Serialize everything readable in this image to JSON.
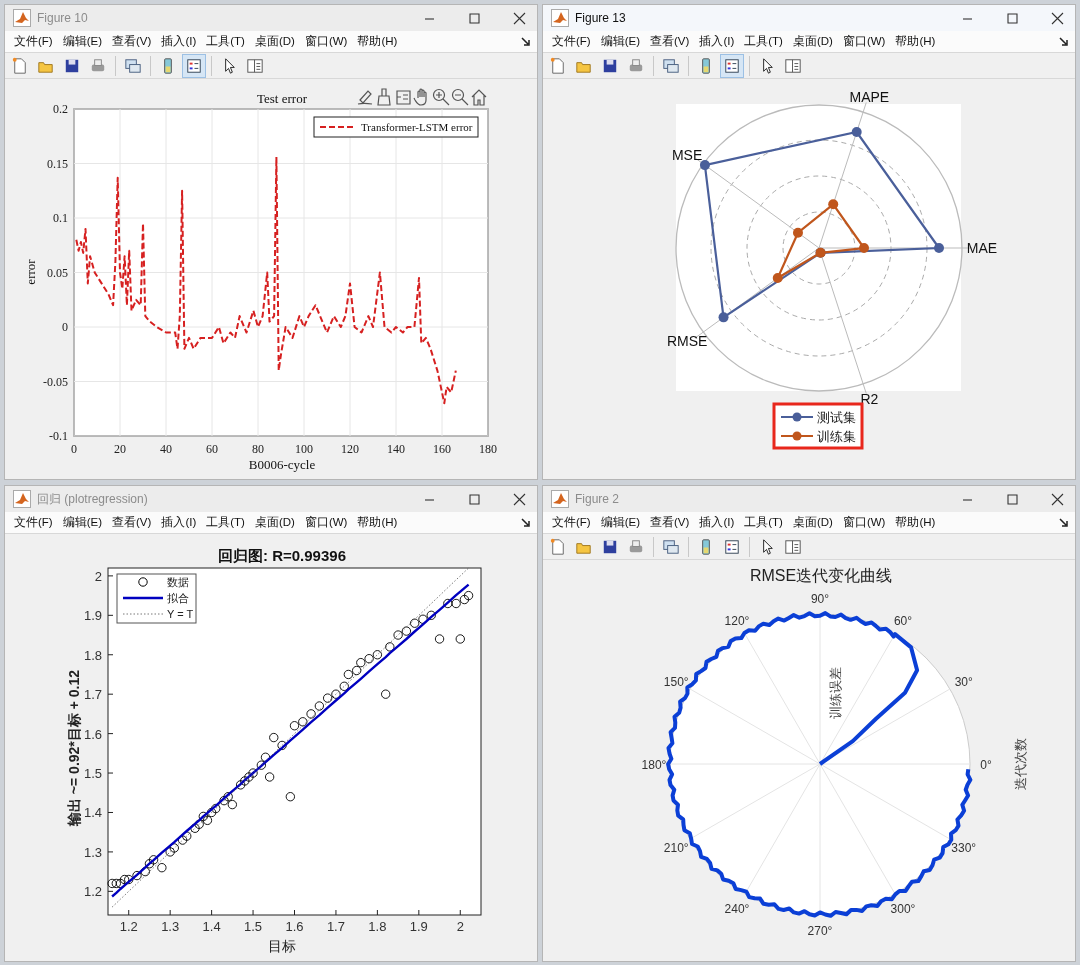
{
  "windows": [
    {
      "kind": "error_plot",
      "title": "Figure 10",
      "active": false,
      "menu": [
        "文件(F)",
        "编辑(E)",
        "查看(V)",
        "插入(I)",
        "工具(T)",
        "桌面(D)",
        "窗口(W)",
        "帮助(H)"
      ],
      "toolbar": [
        {
          "kind": "new",
          "selected": false
        },
        {
          "kind": "open",
          "selected": false
        },
        {
          "kind": "save",
          "selected": false
        },
        {
          "kind": "print",
          "selected": false
        },
        {
          "kind": "link",
          "selected": false
        },
        {
          "kind": "colorbar",
          "selected": false
        },
        {
          "kind": "legend",
          "selected": true
        },
        {
          "kind": "pointer",
          "selected": false
        },
        {
          "kind": "panel",
          "selected": false
        }
      ],
      "axes_toolbar": true,
      "chart_data": {
        "type": "line",
        "title": "Test error",
        "xlabel": "B0006-cycle",
        "ylabel": "error",
        "x": [
          1,
          2,
          3,
          4,
          5,
          6,
          7,
          9,
          12,
          15,
          17,
          18,
          19,
          20,
          21,
          22,
          23,
          24,
          25,
          27,
          29,
          30,
          31,
          33,
          36,
          40,
          44,
          45,
          46,
          47,
          48,
          50,
          52,
          55,
          60,
          63,
          65,
          68,
          70,
          72,
          75,
          78,
          80,
          82,
          84,
          85,
          87,
          88,
          89,
          90,
          92,
          95,
          98,
          100,
          102,
          105,
          108,
          110,
          113,
          116,
          118,
          120,
          122,
          125,
          128,
          130,
          133,
          135,
          138,
          140,
          143,
          145,
          148,
          150,
          151,
          153,
          155,
          158,
          160,
          161,
          162,
          164,
          166
        ],
        "series": [
          {
            "name": "Transformer-LSTM error",
            "color": "#d62020",
            "line_style": "dashed",
            "values": [
              0.08,
              0.07,
              0.078,
              0.068,
              0.09,
              0.04,
              0.065,
              0.05,
              0.04,
              0.03,
              0.02,
              0.06,
              0.137,
              0.05,
              0.035,
              0.065,
              0.02,
              0.07,
              0.015,
              0.025,
              0.02,
              0.095,
              0.01,
              0.005,
              0,
              -0.005,
              -0.005,
              -0.02,
              0.01,
              0.125,
              -0.02,
              -0.01,
              -0.02,
              -0.01,
              -0.01,
              0,
              -0.015,
              -0.005,
              -0.01,
              0.01,
              -0.005,
              0.015,
              0,
              0.01,
              0.05,
              0.005,
              0.01,
              0.156,
              -0.04,
              -0.025,
              0,
              -0.01,
              0.01,
              0,
              0.01,
              0.02,
              0.005,
              -0.005,
              0.01,
              0,
              0.01,
              0.04,
              0,
              -0.005,
              0.01,
              0,
              0.05,
              0,
              -0.005,
              0,
              -0.005,
              0,
              0,
              0.045,
              -0.015,
              -0.01,
              -0.02,
              -0.04,
              -0.06,
              -0.07,
              -0.055,
              -0.06,
              -0.04
            ]
          }
        ],
        "legend": "upper right",
        "grid": true,
        "xlim": [
          0,
          180
        ],
        "ylim": [
          -0.1,
          0.2
        ],
        "xticks": [
          0,
          20,
          40,
          60,
          80,
          100,
          120,
          140,
          160,
          180
        ],
        "yticks": [
          -0.1,
          -0.05,
          0,
          0.05,
          0.1,
          0.15,
          0.2
        ]
      }
    },
    {
      "kind": "radar",
      "title": "Figure 13",
      "active": true,
      "menu": [
        "文件(F)",
        "编辑(E)",
        "查看(V)",
        "插入(I)",
        "工具(T)",
        "桌面(D)",
        "窗口(W)",
        "帮助(H)"
      ],
      "toolbar": [
        {
          "kind": "new",
          "selected": false
        },
        {
          "kind": "open",
          "selected": false
        },
        {
          "kind": "save",
          "selected": false
        },
        {
          "kind": "print",
          "selected": false
        },
        {
          "kind": "link",
          "selected": false
        },
        {
          "kind": "colorbar",
          "selected": false
        },
        {
          "kind": "legend",
          "selected": true
        },
        {
          "kind": "pointer",
          "selected": false
        },
        {
          "kind": "panel",
          "selected": false
        }
      ],
      "axes": [
        "MAE",
        "MAPE",
        "MSE",
        "RMSE",
        "R2"
      ],
      "legend": [
        {
          "label": "测试集",
          "color": "#4a5f9a"
        },
        {
          "label": "训练集",
          "color": "#c0561c"
        }
      ],
      "legend_marked": true
    },
    {
      "kind": "regression",
      "title": "回归 (plotregression)",
      "active": false,
      "menu": [
        "文件(F)",
        "编辑(E)",
        "查看(V)",
        "插入(I)",
        "工具(T)",
        "桌面(D)",
        "窗口(W)",
        "帮助(H)"
      ],
      "chart_data": {
        "type": "scatter",
        "title": "回归图: R=0.99396",
        "xlabel": "目标",
        "ylabel": "输出 ~= 0.92*目标 + 0.12",
        "x": [
          1.16,
          1.17,
          1.18,
          1.19,
          1.2,
          1.22,
          1.24,
          1.25,
          1.26,
          1.28,
          1.3,
          1.31,
          1.33,
          1.34,
          1.36,
          1.37,
          1.38,
          1.39,
          1.4,
          1.41,
          1.43,
          1.44,
          1.45,
          1.47,
          1.48,
          1.49,
          1.5,
          1.52,
          1.53,
          1.54,
          1.55,
          1.57,
          1.59,
          1.6,
          1.62,
          1.64,
          1.66,
          1.68,
          1.7,
          1.72,
          1.73,
          1.75,
          1.76,
          1.78,
          1.8,
          1.82,
          1.83,
          1.85,
          1.87,
          1.89,
          1.91,
          1.93,
          1.95,
          1.97,
          1.99,
          2,
          2.01,
          2.02
        ],
        "series": [
          {
            "name": "数据",
            "type": "scatter",
            "color": "#000000",
            "values": [
              1.22,
              1.22,
              1.22,
              1.23,
              1.23,
              1.24,
              1.25,
              1.27,
              1.28,
              1.26,
              1.3,
              1.31,
              1.33,
              1.34,
              1.36,
              1.37,
              1.39,
              1.38,
              1.4,
              1.41,
              1.43,
              1.44,
              1.42,
              1.47,
              1.48,
              1.49,
              1.5,
              1.52,
              1.54,
              1.49,
              1.59,
              1.57,
              1.44,
              1.62,
              1.63,
              1.65,
              1.67,
              1.69,
              1.7,
              1.72,
              1.75,
              1.76,
              1.78,
              1.79,
              1.8,
              1.7,
              1.82,
              1.85,
              1.86,
              1.88,
              1.89,
              1.9,
              1.84,
              1.93,
              1.93,
              1.84,
              1.94,
              1.95
            ]
          },
          {
            "name": "拟合",
            "type": "line",
            "line_style": "solid",
            "color": "#0000c0",
            "values": [
              1.187,
              1.196,
              1.206,
              1.215,
              1.224,
              1.242,
              1.261,
              1.27,
              1.279,
              1.298,
              1.316,
              1.325,
              1.344,
              1.353,
              1.371,
              1.38,
              1.39,
              1.399,
              1.408,
              1.417,
              1.436,
              1.445,
              1.454,
              1.472,
              1.482,
              1.491,
              1.5,
              1.518,
              1.528,
              1.537,
              1.546,
              1.564,
              1.583,
              1.592,
              1.61,
              1.629,
              1.647,
              1.666,
              1.684,
              1.702,
              1.712,
              1.73,
              1.739,
              1.758,
              1.776,
              1.794,
              1.804,
              1.822,
              1.84,
              1.859,
              1.877,
              1.896,
              1.914,
              1.932,
              1.951,
              1.96,
              1.969,
              1.978
            ]
          },
          {
            "name": "Y = T",
            "type": "line",
            "line_style": "dotted",
            "color": "#555555",
            "values": [
              1.16,
              1.17,
              1.18,
              1.19,
              1.2,
              1.22,
              1.24,
              1.25,
              1.26,
              1.28,
              1.3,
              1.31,
              1.33,
              1.34,
              1.36,
              1.37,
              1.38,
              1.39,
              1.4,
              1.41,
              1.43,
              1.44,
              1.45,
              1.47,
              1.48,
              1.49,
              1.5,
              1.52,
              1.53,
              1.54,
              1.55,
              1.57,
              1.59,
              1.6,
              1.62,
              1.64,
              1.66,
              1.68,
              1.7,
              1.72,
              1.73,
              1.75,
              1.76,
              1.78,
              1.8,
              1.82,
              1.83,
              1.85,
              1.87,
              1.89,
              1.91,
              1.93,
              1.95,
              1.97,
              1.99,
              2,
              2.01,
              2.02
            ]
          }
        ],
        "legend": "upper left",
        "xlim": [
          1.15,
          2.05
        ],
        "ylim": [
          1.14,
          2.02
        ],
        "xticks": [
          1.2,
          1.3,
          1.4,
          1.5,
          1.6,
          1.7,
          1.8,
          1.9,
          2
        ],
        "yticks": [
          1.2,
          1.3,
          1.4,
          1.5,
          1.6,
          1.7,
          1.8,
          1.9,
          2
        ]
      }
    },
    {
      "kind": "polar",
      "title": "Figure 2",
      "active": false,
      "menu": [
        "文件(F)",
        "编辑(E)",
        "查看(V)",
        "插入(I)",
        "工具(T)",
        "桌面(D)",
        "窗口(W)",
        "帮助(H)"
      ],
      "toolbar": [
        {
          "kind": "new",
          "selected": false
        },
        {
          "kind": "open",
          "selected": false
        },
        {
          "kind": "save",
          "selected": false
        },
        {
          "kind": "print",
          "selected": false
        },
        {
          "kind": "link",
          "selected": false
        },
        {
          "kind": "colorbar",
          "selected": false
        },
        {
          "kind": "legend",
          "selected": false
        },
        {
          "kind": "pointer",
          "selected": false
        },
        {
          "kind": "panel",
          "selected": false
        }
      ],
      "plot_title": "RMSE迭代变化曲线",
      "angle_labels": [
        "0°",
        "30°",
        "60°",
        "90°",
        "120°",
        "150°",
        "180°",
        "210°",
        "240°",
        "270°",
        "300°",
        "330°"
      ],
      "r_label": "训练误差",
      "side_label": "迭代次数"
    }
  ]
}
